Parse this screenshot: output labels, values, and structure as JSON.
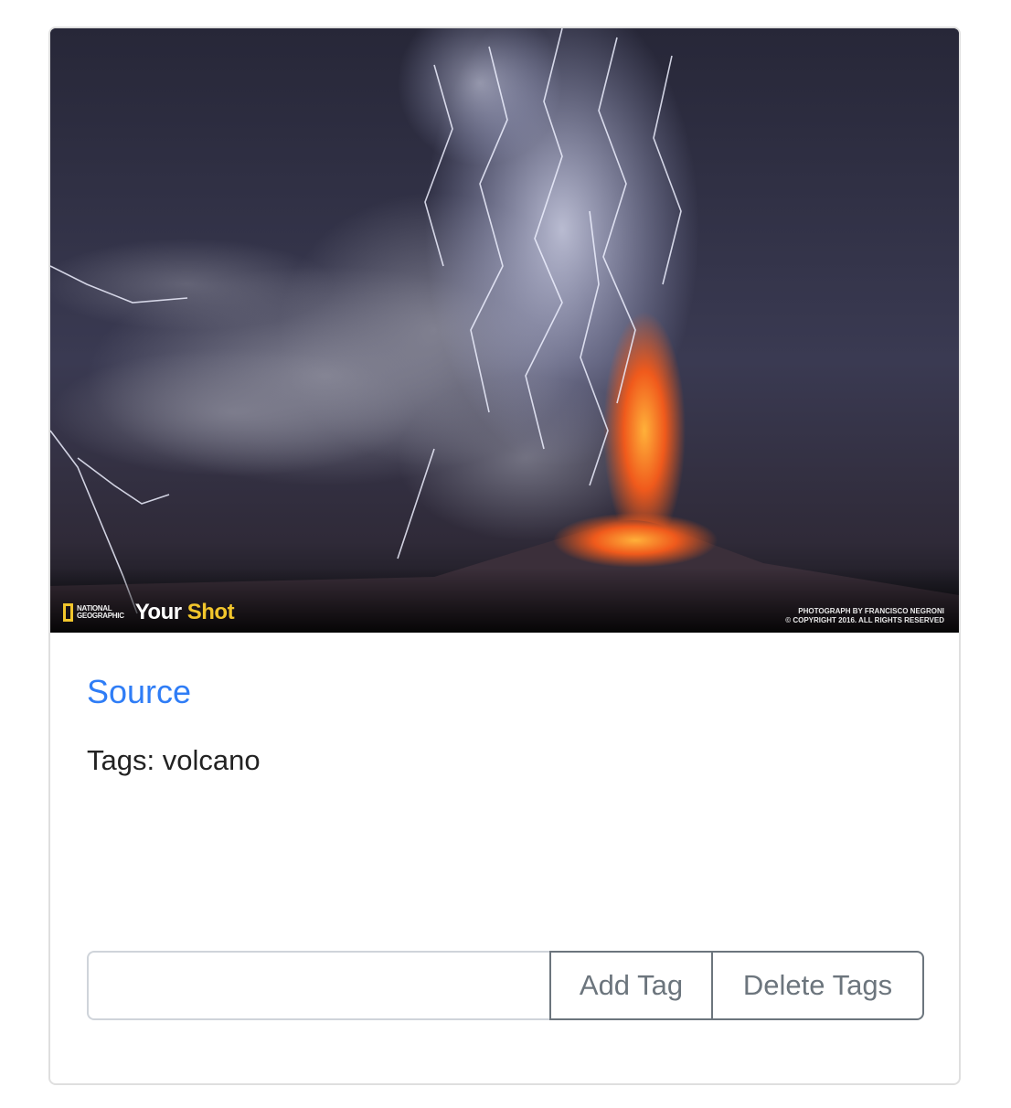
{
  "card": {
    "image": {
      "description_icon": "volcano-photo",
      "watermark_logo_top": "NATIONAL",
      "watermark_logo_bottom": "GEOGRAPHIC",
      "watermark_brand_your": "Your",
      "watermark_brand_shot": "Shot",
      "credit_line_1": "PHOTOGRAPH BY FRANCISCO NEGRONI",
      "credit_line_2": "© COPYRIGHT 2016. ALL RIGHTS RESERVED"
    },
    "source_label": "Source",
    "tags_text": "Tags: volcano",
    "tag_input": {
      "value": "",
      "placeholder": ""
    },
    "add_tag_label": "Add Tag",
    "delete_tags_label": "Delete Tags"
  },
  "colors": {
    "link": "#2f7df6",
    "button_outline": "#6c757d",
    "border": "#dfdfdf"
  }
}
